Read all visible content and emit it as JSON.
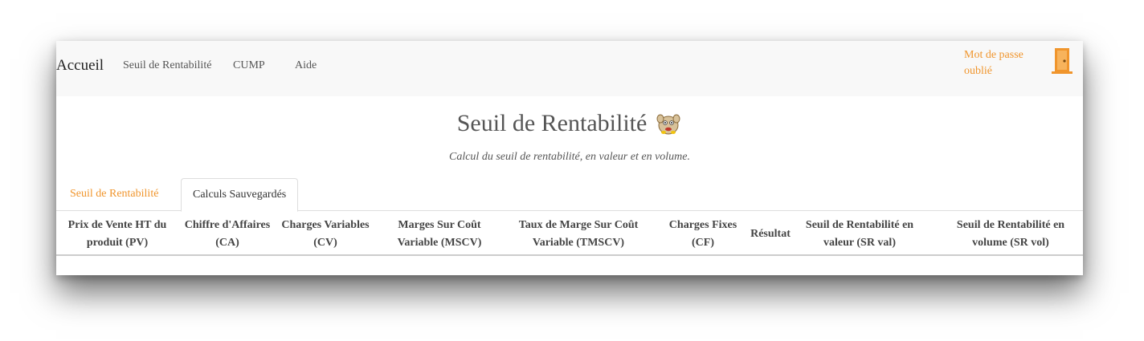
{
  "nav": {
    "brand": "Accueil",
    "links": [
      "Seuil de Rentabilité",
      "CUMP",
      "Aide"
    ],
    "forgot_password": "Mot de passe oublié",
    "door_icon": "door-exit-icon",
    "accent_color": "#f0952c"
  },
  "header": {
    "title": "Seuil de Rentabilité",
    "mascot_icon": "mascot-icon",
    "subtitle": "Calcul du seuil de rentabilité, en valeur et en volume."
  },
  "tabs": [
    {
      "label": "Seuil de Rentabilité",
      "active": false
    },
    {
      "label": "Calculs Sauvegardés",
      "active": true
    }
  ],
  "table": {
    "columns": [
      "Prix de Vente HT du produit (PV)",
      "Chiffre d'Affaires (CA)",
      "Charges Variables (CV)",
      "Marges Sur Coût Variable (MSCV)",
      "Taux de Marge Sur Coût Variable (TMSCV)",
      "Charges Fixes (CF)",
      "Résultat",
      "Seuil de Rentabilité en valeur (SR val)",
      "Seuil de Rentabilité en volume (SR vol)"
    ],
    "rows": []
  }
}
